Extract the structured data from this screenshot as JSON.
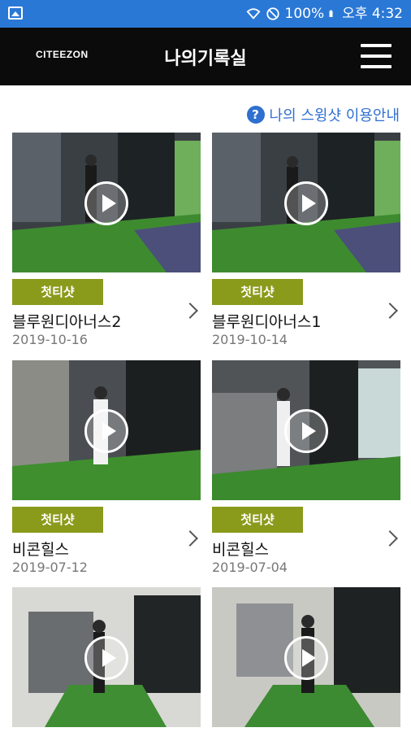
{
  "status_bar": {
    "battery": "100%",
    "time": "오후 4:32",
    "icons": [
      "image-icon",
      "wifi-icon",
      "no-disturb-icon",
      "battery-icon"
    ]
  },
  "header": {
    "logo": "CITEEZON",
    "title": "나의기록실",
    "menu_icon": "hamburger-menu-icon"
  },
  "guide": {
    "label": "나의 스윙샷 이용안내",
    "icon": "question-circle-icon"
  },
  "videos": [
    {
      "badge": "첫티샷",
      "title": "블루원디아너스2",
      "date": "2019-10-16"
    },
    {
      "badge": "첫티샷",
      "title": "블루원디아너스1",
      "date": "2019-10-14"
    },
    {
      "badge": "첫티샷",
      "title": "비콘힐스",
      "date": "2019-07-12"
    },
    {
      "badge": "첫티샷",
      "title": "비콘힐스",
      "date": "2019-07-04"
    },
    {
      "badge": "",
      "title": "",
      "date": ""
    },
    {
      "badge": "",
      "title": "",
      "date": ""
    }
  ],
  "colors": {
    "status_bar": "#2a78d6",
    "header": "#0b0b0b",
    "badge": "#8a9a1b",
    "link": "#2f6fd0"
  }
}
